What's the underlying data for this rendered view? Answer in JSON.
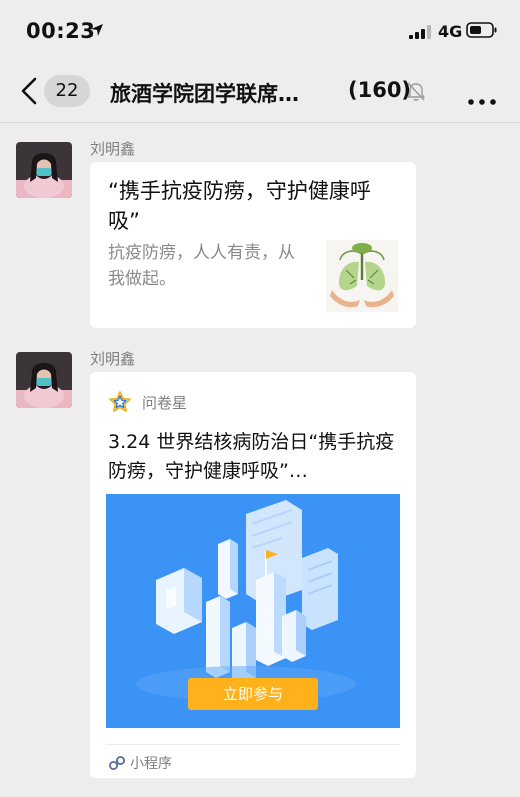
{
  "status_bar": {
    "time": "00:23",
    "network": "4G",
    "icons": [
      "location-arrow-icon",
      "signal-icon",
      "battery-icon"
    ]
  },
  "nav": {
    "unread_count": "22",
    "title": "旅酒学院团学联席…",
    "member_count": "(160)",
    "icons": [
      "back-chevron-icon",
      "mute-bell-icon",
      "more-dots-icon"
    ]
  },
  "messages": [
    {
      "sender": "刘明鑫",
      "type": "link",
      "title": "“携手抗疫防痨，守护健康呼吸”",
      "description": "抗疫防痨，人人有责，从我做起。",
      "thumbnail_icon": "lungs-tree-icon"
    },
    {
      "sender": "刘明鑫",
      "type": "mini_program",
      "source_name": "问卷星",
      "source_icon": "star-outline-icon",
      "title": "3.24 世界结核病防治日“携手抗疫防痨，守护健康呼吸”…",
      "action_label": "立即参与",
      "footer_label": "小程序",
      "footer_icon": "mini-program-icon"
    }
  ],
  "colors": {
    "background": "#ededed",
    "bubble": "#ffffff",
    "cover_blue": "#3a93f5",
    "action_orange": "#ffb11b",
    "secondary_text": "#8a8a8a"
  }
}
